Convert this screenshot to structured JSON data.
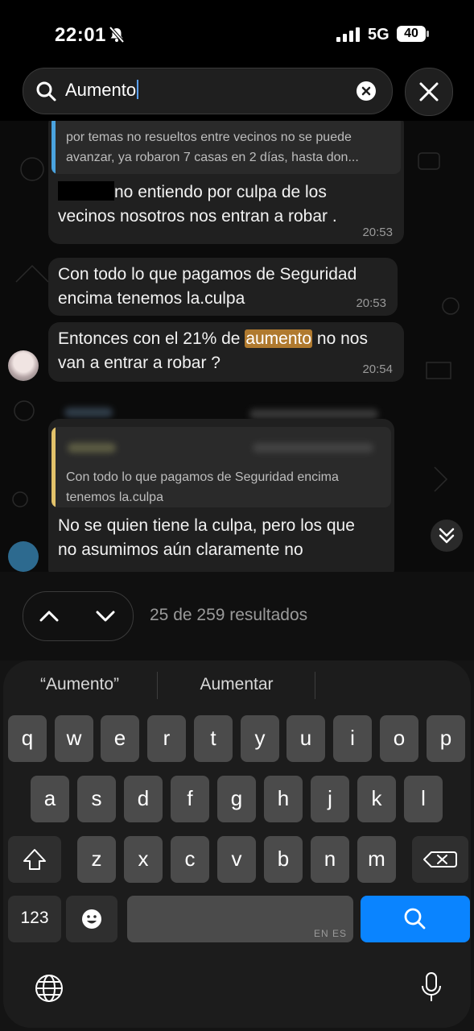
{
  "status_bar": {
    "time": "22:01",
    "network": "5G",
    "battery": "40",
    "bell_muted_icon": "bell-slash-icon",
    "signal_icon": "signal-bars-icon"
  },
  "search": {
    "query": "Aumento",
    "search_icon": "magnifier-icon",
    "clear_icon": "clear-icon",
    "close_icon": "close-icon"
  },
  "chat": {
    "quote1": {
      "line1": "por temas no resueltos entre vecinos no se puede",
      "line2": "avanzar, ya robaron 7 casas en 2 días, hasta don..."
    },
    "msg1": {
      "line1_after_redaction": "no entiendo por culpa de los",
      "line2": "vecinos nosotros nos entran a robar .",
      "time": "20:53"
    },
    "msg2": {
      "line1": "Con todo lo que pagamos de Seguridad",
      "line2": "encima tenemos la.culpa",
      "time": "20:53"
    },
    "msg3": {
      "line1_before": "Entonces con el 21% de ",
      "highlight": "aumento",
      "line1_after": " no nos",
      "line2": "van a entrar a robar ?",
      "time": "20:54"
    },
    "quote2": {
      "line1": "Con todo lo que pagamos de Seguridad encima",
      "line2": "tenemos la.culpa"
    },
    "msg4": {
      "line1": "No se quien tiene la culpa, pero los que",
      "line2": "no asumimos aún claramente no"
    },
    "scroll_icon": "double-chevron-down-icon"
  },
  "results": {
    "count_text": "25 de 259 resultados",
    "prev_icon": "chevron-up-icon",
    "next_icon": "chevron-down-icon"
  },
  "keyboard": {
    "suggestions": [
      "“Aumento”",
      "Aumentar"
    ],
    "row1": [
      "q",
      "w",
      "e",
      "r",
      "t",
      "y",
      "u",
      "i",
      "o",
      "p"
    ],
    "row2": [
      "a",
      "s",
      "d",
      "f",
      "g",
      "h",
      "j",
      "k",
      "l"
    ],
    "row3": [
      "z",
      "x",
      "c",
      "v",
      "b",
      "n",
      "m"
    ],
    "numbers_key": "123",
    "space_lang": "EN ES",
    "shift_icon": "shift-icon",
    "delete_icon": "backspace-icon",
    "emoji_icon": "emoji-icon",
    "search_key_icon": "search-icon",
    "globe_icon": "globe-icon",
    "mic_icon": "microphone-icon",
    "accent_color": "#0a84ff"
  },
  "colors": {
    "highlight": "#b07a2f",
    "quote_bar_1": "#4aa3df",
    "quote_bar_2": "#e3c26a"
  }
}
